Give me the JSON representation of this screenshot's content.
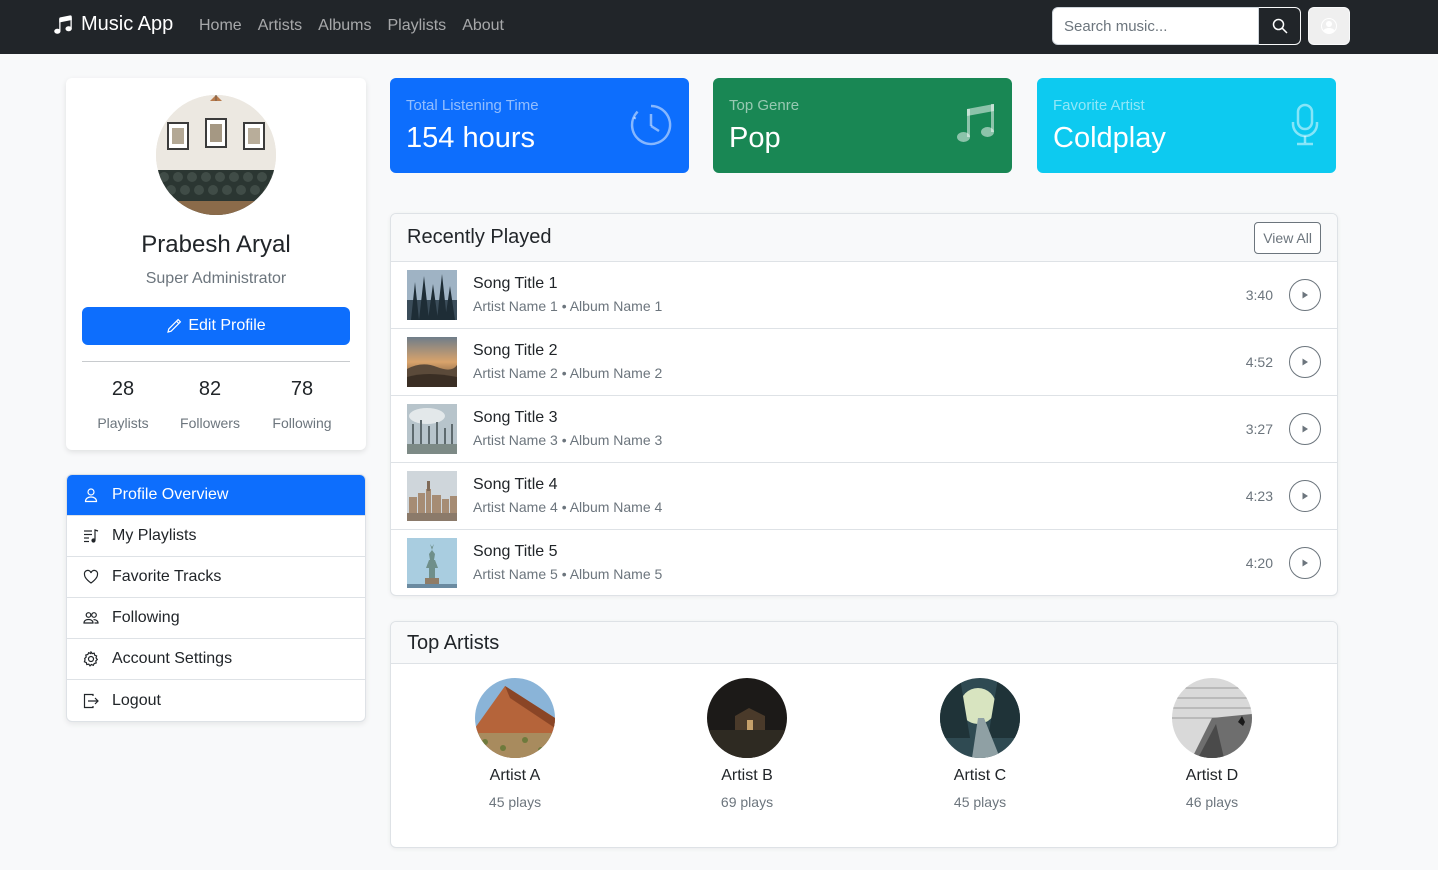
{
  "navbar": {
    "brand": "Music App",
    "links": [
      "Home",
      "Artists",
      "Albums",
      "Playlists",
      "About"
    ],
    "search_placeholder": "Search music...",
    "icons": {
      "brand": "music-note-icon",
      "search": "search-icon",
      "user": "user-circle-icon"
    }
  },
  "profile": {
    "name": "Prabesh Aryal",
    "role": "Super Administrator",
    "edit_label": "Edit Profile",
    "stats": [
      {
        "value": "28",
        "label": "Playlists"
      },
      {
        "value": "82",
        "label": "Followers"
      },
      {
        "value": "78",
        "label": "Following"
      }
    ]
  },
  "menu": {
    "items": [
      {
        "label": "Profile Overview",
        "icon": "person-icon",
        "active": true
      },
      {
        "label": "My Playlists",
        "icon": "playlist-icon",
        "active": false
      },
      {
        "label": "Favorite Tracks",
        "icon": "heart-icon",
        "active": false
      },
      {
        "label": "Following",
        "icon": "people-icon",
        "active": false
      },
      {
        "label": "Account Settings",
        "icon": "gear-icon",
        "active": false
      },
      {
        "label": "Logout",
        "icon": "logout-icon",
        "active": false
      }
    ]
  },
  "stat_cards": [
    {
      "label": "Total Listening Time",
      "value": "154 hours",
      "icon": "clock-icon",
      "color": "#0d6efd"
    },
    {
      "label": "Top Genre",
      "value": "Pop",
      "icon": "music-notes-icon",
      "color": "#198754"
    },
    {
      "label": "Favorite Artist",
      "value": "Coldplay",
      "icon": "microphone-icon",
      "color": "#0dcaf0"
    }
  ],
  "recently_played": {
    "title": "Recently Played",
    "view_all": "View All",
    "songs": [
      {
        "title": "Song Title 1",
        "meta": "Artist Name 1 • Album Name 1",
        "duration": "3:40"
      },
      {
        "title": "Song Title 2",
        "meta": "Artist Name 2 • Album Name 2",
        "duration": "4:52"
      },
      {
        "title": "Song Title 3",
        "meta": "Artist Name 3 • Album Name 3",
        "duration": "3:27"
      },
      {
        "title": "Song Title 4",
        "meta": "Artist Name 4 • Album Name 4",
        "duration": "4:23"
      },
      {
        "title": "Song Title 5",
        "meta": "Artist Name 5 • Album Name 5",
        "duration": "4:20"
      }
    ]
  },
  "top_artists": {
    "title": "Top Artists",
    "artists": [
      {
        "name": "Artist A",
        "plays": "45 plays"
      },
      {
        "name": "Artist B",
        "plays": "69 plays"
      },
      {
        "name": "Artist C",
        "plays": "45 plays"
      },
      {
        "name": "Artist D",
        "plays": "46 plays"
      }
    ]
  }
}
